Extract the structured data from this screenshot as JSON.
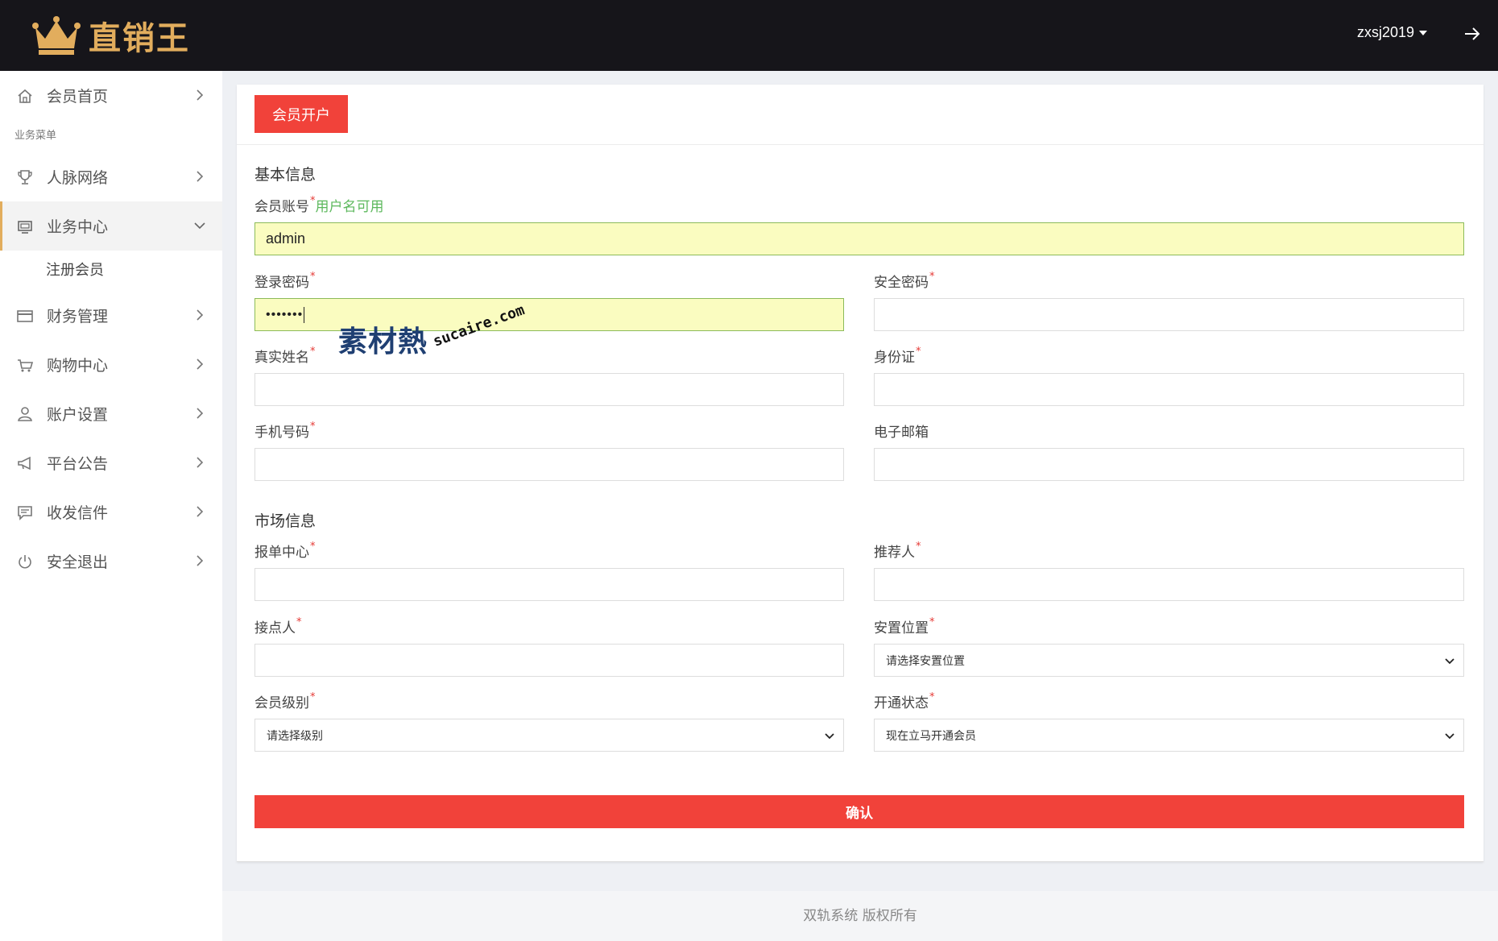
{
  "header": {
    "logo_text": "直销王",
    "username": "zxsj2019"
  },
  "sidebar": {
    "home": "会员首页",
    "section_label": "业务菜单",
    "items": [
      {
        "label": "人脉网络",
        "icon": "trophy-icon"
      },
      {
        "label": "业务中心",
        "icon": "monitor-icon",
        "expanded": true,
        "children": [
          "注册会员"
        ]
      },
      {
        "label": "财务管理",
        "icon": "card-icon"
      },
      {
        "label": "购物中心",
        "icon": "cart-icon"
      },
      {
        "label": "账户设置",
        "icon": "user-icon"
      },
      {
        "label": "平台公告",
        "icon": "megaphone-icon"
      },
      {
        "label": "收发信件",
        "icon": "message-icon"
      },
      {
        "label": "安全退出",
        "icon": "power-icon"
      }
    ]
  },
  "form": {
    "tab_label": "会员开户",
    "basic_section": "基本信息",
    "account_label": "会员账号",
    "account_ok": "用户名可用",
    "account_value": "admin",
    "login_pw_label": "登录密码",
    "login_pw_value": "•••••••",
    "security_pw_label": "安全密码",
    "real_name_label": "真实姓名",
    "id_card_label": "身份证",
    "phone_label": "手机号码",
    "email_label": "电子邮箱",
    "market_section": "市场信息",
    "report_center_label": "报单中心",
    "referrer_label": "推荐人",
    "contact_label": "接点人",
    "position_label": "安置位置",
    "position_value": "请选择安置位置",
    "level_label": "会员级别",
    "level_value": "请选择级别",
    "status_label": "开通状态",
    "status_value": "现在立马开通会员",
    "required_mark": "*",
    "confirm_label": "确认"
  },
  "footer": {
    "text": "双轨系统 版权所有"
  },
  "watermark": {
    "cn": "素材熱",
    "en": "sucaire.com"
  },
  "colors": {
    "topbar": "#16151a",
    "brand_gold": "#e2ad5d",
    "primary_red": "#f1423a",
    "autofill_bg": "#fafcc0",
    "ok_green": "#5cb85c"
  }
}
